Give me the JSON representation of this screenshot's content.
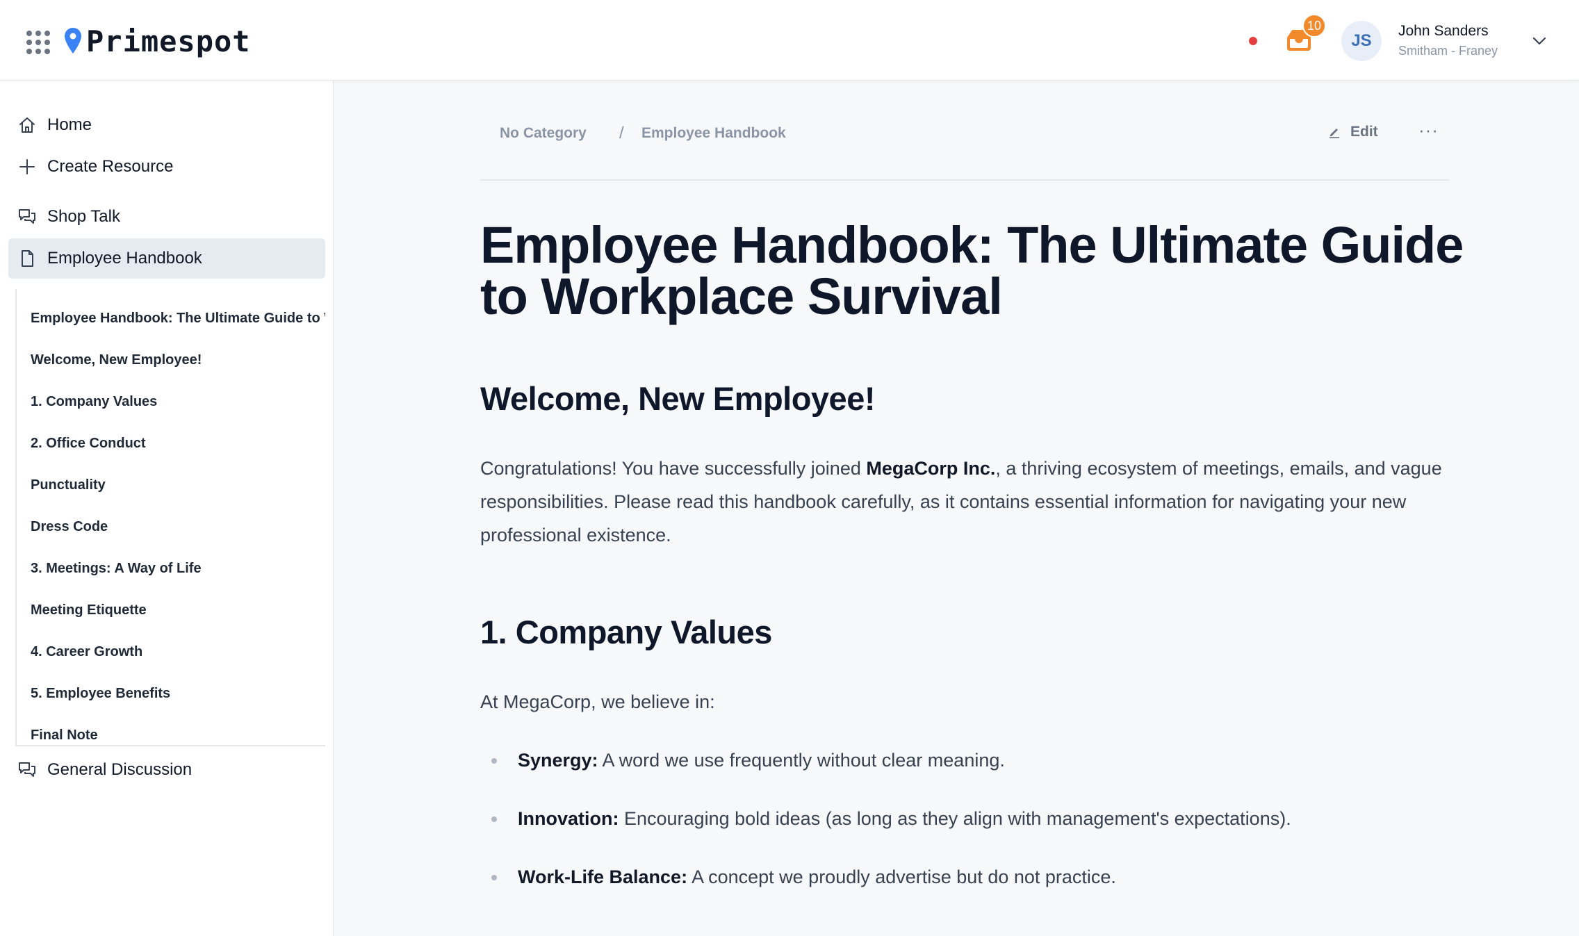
{
  "app": {
    "brand": "Primespot"
  },
  "header": {
    "notification_count": "10",
    "user": {
      "initials": "JS",
      "name": "John Sanders",
      "org": "Smitham - Franey"
    },
    "colors": {
      "status_dot": "#e53e3e",
      "badge": "#f28a2c",
      "brand_pin": "#3b82f6"
    }
  },
  "sidebar": {
    "items": [
      {
        "label": "Home",
        "icon": "home-icon"
      },
      {
        "label": "Create Resource",
        "icon": "plus-icon"
      },
      {
        "label": "Shop Talk",
        "icon": "chat-icon"
      },
      {
        "label": "Employee Handbook",
        "icon": "document-icon",
        "active": true
      },
      {
        "label": "General Discussion",
        "icon": "chat-icon"
      }
    ],
    "toc": [
      "Employee Handbook: The Ultimate Guide to Workplace Survival",
      "Welcome, New Employee!",
      "1. Company Values",
      "2. Office Conduct",
      "Punctuality",
      "Dress Code",
      "3. Meetings: A Way of Life",
      "Meeting Etiquette",
      "4. Career Growth",
      "5. Employee Benefits",
      "Final Note"
    ]
  },
  "breadcrumb": {
    "category": "No Category",
    "separator": "/",
    "page": "Employee Handbook",
    "edit_label": "Edit",
    "more_label": "···"
  },
  "document": {
    "title": "Employee Handbook: The Ultimate Guide to Workplace Survival",
    "sections": [
      {
        "heading": "Welcome, New Employee!",
        "intro_before": "Congratulations! You have successfully joined ",
        "intro_bold": "MegaCorp Inc.",
        "intro_after": ", a thriving ecosystem of meetings, emails, and vague responsibilities. Please read this handbook carefully, as it contains essential information for navigating your new professional existence."
      },
      {
        "heading": "1. Company Values",
        "lead": "At MegaCorp, we believe in:",
        "bullets": [
          {
            "term": "Synergy:",
            "text": " A word we use frequently without clear meaning."
          },
          {
            "term": "Innovation:",
            "text": " Encouraging bold ideas (as long as they align with management's expectations)."
          },
          {
            "term": "Work-Life Balance:",
            "text": " A concept we proudly advertise but do not practice."
          }
        ]
      }
    ]
  }
}
